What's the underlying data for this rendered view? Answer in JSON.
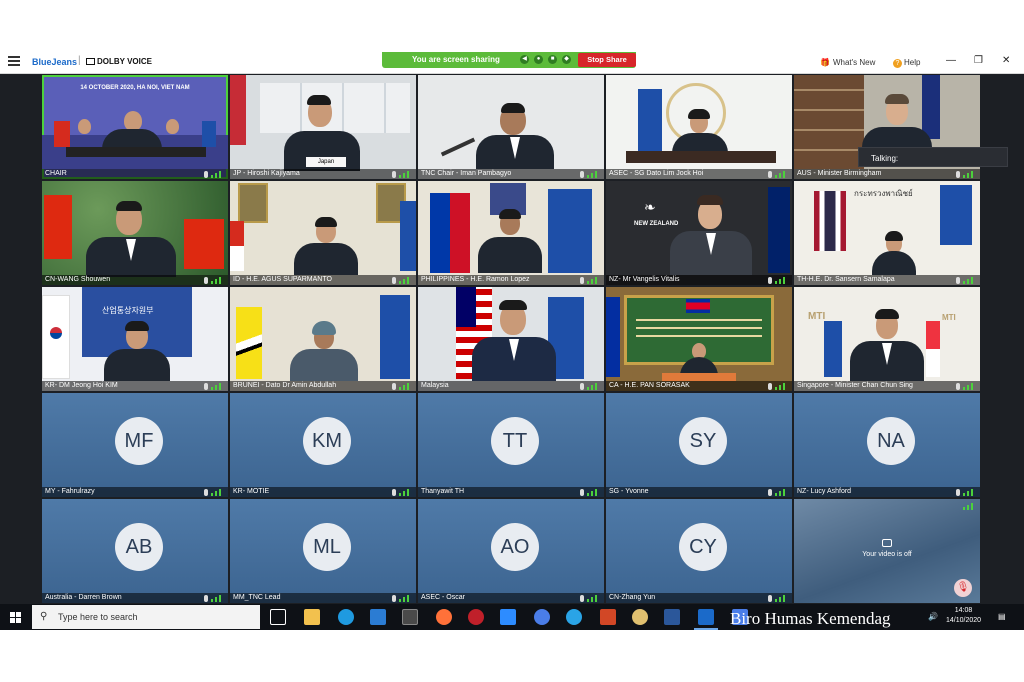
{
  "app": {
    "brand": "BlueJeans",
    "partner": "DOLBY VOICE"
  },
  "share_bar": {
    "text": "You are screen sharing",
    "stop_label": "Stop Share"
  },
  "top_right": {
    "whats_new": "What's New",
    "help": "Help"
  },
  "talking_popup": "Talking:",
  "video_tiles": [
    {
      "label": "CHAIR",
      "banner": "14 OCTOBER 2020, HA NOI, VIET NAM",
      "active": true
    },
    {
      "label": "JP - Hiroshi Kajiyama",
      "sign": "Japan"
    },
    {
      "label": "TNC Chair - Iman Pambagyo"
    },
    {
      "label": "ASEC - SG Dato Lim Jock Hoi"
    },
    {
      "label": "AUS - Minister Birmingham"
    },
    {
      "label": "CN-WANG Shouwen"
    },
    {
      "label": "ID - H.E. AGUS SUPARMANTO"
    },
    {
      "label": "PHILIPPINES - H.E. Ramon Lopez"
    },
    {
      "label": "NZ- Mr Vangelis Vitalis",
      "sign": "NEW ZEALAND"
    },
    {
      "label": "TH-H.E. Dr. Sansern Samalapa",
      "sign": "กระทรวงพาณิชย์"
    },
    {
      "label": "KR- DM Jeong Hoi KIM",
      "sign": "산업통상자원부"
    },
    {
      "label": "BRUNEI - Dato Dr Amin Abdullah"
    },
    {
      "label": "Malaysia"
    },
    {
      "label": "CA - H.E. PAN SORASAK"
    },
    {
      "label": "Singapore - Minister Chan Chun Sing",
      "sign": "MTI"
    }
  ],
  "avatar_tiles": [
    {
      "initials": "MF",
      "label": "MY - Fahrulrazy"
    },
    {
      "initials": "KM",
      "label": "KR- MOTIE"
    },
    {
      "initials": "TT",
      "label": "Thanyawit TH"
    },
    {
      "initials": "SY",
      "label": "SG - Yvonne"
    },
    {
      "initials": "NA",
      "label": "NZ- Lucy Ashford"
    },
    {
      "initials": "AB",
      "label": "Australia - Darren Brown"
    },
    {
      "initials": "ML",
      "label": "MM_TNC Lead"
    },
    {
      "initials": "AO",
      "label": "ASEC - Oscar"
    },
    {
      "initials": "CY",
      "label": "CN-Zhang Yun"
    }
  ],
  "self_view": {
    "text": "Your video is off"
  },
  "taskbar": {
    "search_placeholder": "Type here to search",
    "time": "14:08",
    "date": "14/10/2020"
  },
  "watermark": "Biro Humas Kemendag",
  "colors": {
    "share_green": "#5cbb3a",
    "stop_red": "#d7262a",
    "brand_blue": "#1b6ac9",
    "avatar_bg": "#4f7aa8"
  }
}
